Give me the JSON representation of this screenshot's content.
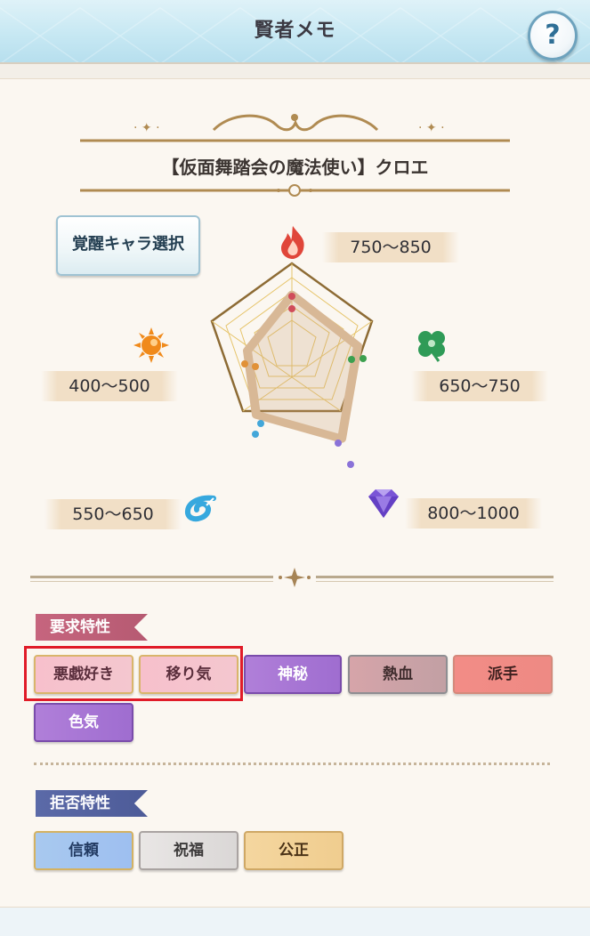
{
  "header": {
    "title": "賢者メモ",
    "help_label": "?"
  },
  "character": {
    "name": "【仮面舞踏会の魔法使い】クロエ"
  },
  "awaken_button": {
    "label": "覚醒キャラ選択"
  },
  "radar": {
    "stats": [
      {
        "icon": "fire-icon",
        "range": "750〜850",
        "color": "#e0463a"
      },
      {
        "icon": "clover-icon",
        "range": "650〜750",
        "color": "#2f9b57"
      },
      {
        "icon": "diamond-icon",
        "range": "800〜1000",
        "color": "#7a55d6"
      },
      {
        "icon": "water-icon",
        "range": "550〜650",
        "color": "#36a8de"
      },
      {
        "icon": "sun-icon",
        "range": "400〜500",
        "color": "#f08a1b"
      }
    ]
  },
  "required": {
    "label": "要求特性",
    "traits": [
      "悪戯好き",
      "移り気",
      "神秘",
      "熱血",
      "派手",
      "色気"
    ]
  },
  "rejected": {
    "label": "拒否特性",
    "traits": [
      "信頼",
      "祝福",
      "公正"
    ]
  }
}
